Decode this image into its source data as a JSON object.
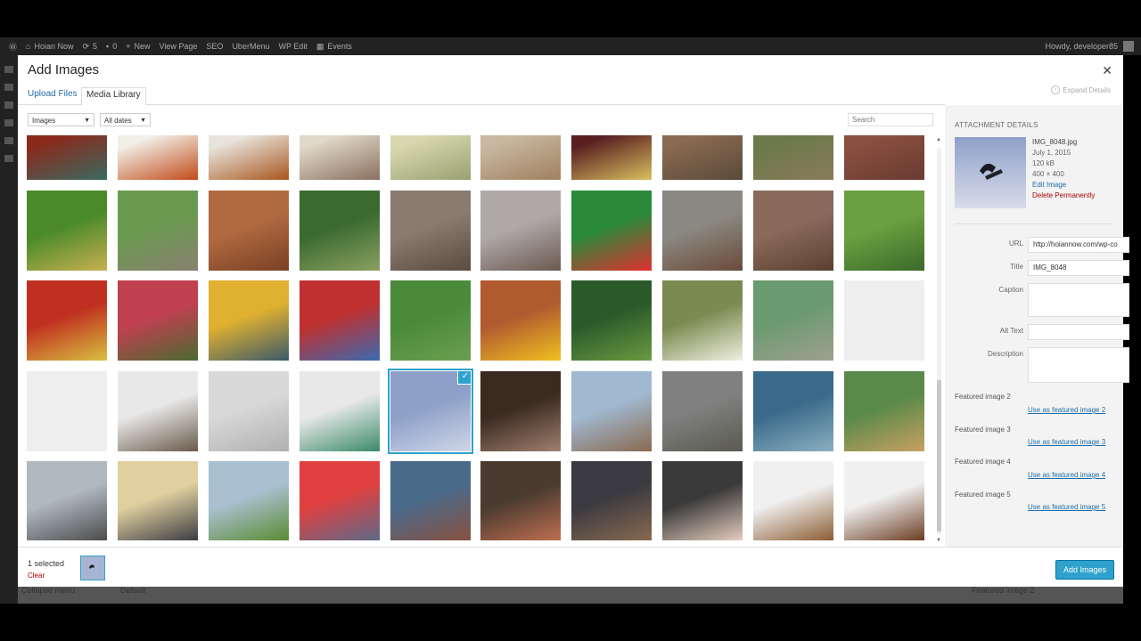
{
  "admin_bar": {
    "site_name": "Hoian Now",
    "updates": "5",
    "comments": "0",
    "new": "New",
    "view_page": "View Page",
    "seo": "SEO",
    "ubermenu": "UberMenu",
    "wp_edit": "WP Edit",
    "events": "Events",
    "howdy": "Howdy, developer85"
  },
  "background": {
    "collapse_menu": "Collapse menu",
    "default": "Default",
    "featured_image_2": "Featured image 2"
  },
  "modal": {
    "title": "Add Images",
    "tabs": [
      {
        "label": "Upload Files"
      },
      {
        "label": "Media Library"
      }
    ],
    "expand_details": "Expand Details",
    "filter_type": "Images",
    "filter_date": "All dates",
    "search_placeholder": "Search"
  },
  "grid": {
    "rows": [
      [
        "#8a2a1c|#3a6a60",
        "#f2efe6|#c24a1a",
        "#e8e4dc|#a8561e",
        "#e0d8c8|#8a7060",
        "#d8d8b0|#9aa070",
        "#c8b8a0|#a08060",
        "#5a2020|#d8c060",
        "#8a6a50|#5a4a3a",
        "#6a7a4a|#8a7a5a",
        "#8a5040|#6a3a30"
      ],
      [
        "#4a8a2a|#c8b050",
        "#6a9a50|#8a8070",
        "#b06a40|#7a4024",
        "#3a6a30|#8aa060",
        "#8a7a70|#5a4a40",
        "#b0a8a8|#6a5a50",
        "#2a8a3a|#e03030",
        "#8a8880|#6a4a3a",
        "#8a6a5a|#5a4030",
        "#6aa040|#3a6a2a"
      ],
      [
        "#c03020|#d8c040",
        "#c04050|#4a6a30",
        "#e0b030|#3a5a6a",
        "#c03030|#3a6ab0",
        "#4a8a3a|#6aa050",
        "#b05a30|#f0c020",
        "#2a5a2a|#6a9a40",
        "#7a8a50|#f0f0e0",
        "#6a9a70|#a0a090",
        "#eeeeee|#eeeeee"
      ],
      [
        "#eeeeee|#eeeeee",
        "#e8e8e8|#6a5a4a",
        "#d8d8d8|#b0b0b0",
        "#e8e8e8|#3a8a6a",
        "#8ea0c8|#cfd6e8",
        "#3a2a20|#a08070",
        "#a0b8d0|#8a6a50",
        "#808080|#5a5a50",
        "#3a6a8a|#8ab0c0",
        "#5a8a4a|#c8a060"
      ],
      [
        "#b0b8c0|#4a4a4a",
        "#e0d0a0|#3a3a40",
        "#a8c0d0|#5a8a30",
        "#e04040|#5a6a8a",
        "#4a6a8a|#8a5040",
        "#4a3a30|#c07050",
        "#3a3a40|#8a6a50",
        "#3a3a3a|#e8d0c0",
        "#f0f0f0|#8a5a30",
        "#f0f0f0|#6a3a20"
      ]
    ],
    "selected": {
      "row": 3,
      "col": 4
    }
  },
  "details": {
    "heading": "ATTACHMENT DETAILS",
    "filename": "IMG_8048.jpg",
    "date": "July 1, 2015",
    "size": "120 kB",
    "dimensions": "400 × 400",
    "edit_image": "Edit Image",
    "delete": "Delete Permanently",
    "url_label": "URL",
    "url_value": "http://hoiannow.com/wp-co",
    "title_label": "Title",
    "title_value": "IMG_8048",
    "caption_label": "Caption",
    "alt_label": "Alt Text",
    "description_label": "Description",
    "featured": [
      {
        "label": "Featured image 2",
        "link": "Use as featured image 2"
      },
      {
        "label": "Featured image 3",
        "link": "Use as featured image 3"
      },
      {
        "label": "Featured image 4",
        "link": "Use as featured image 4"
      },
      {
        "label": "Featured image 5",
        "link": "Use as featured image 5"
      }
    ]
  },
  "footer": {
    "selected_count": "1 selected",
    "clear": "Clear",
    "add_button": "Add Images"
  },
  "colors": {
    "accent": "#2ea2cc",
    "link": "#1e6ca8",
    "danger": "#a00000"
  }
}
